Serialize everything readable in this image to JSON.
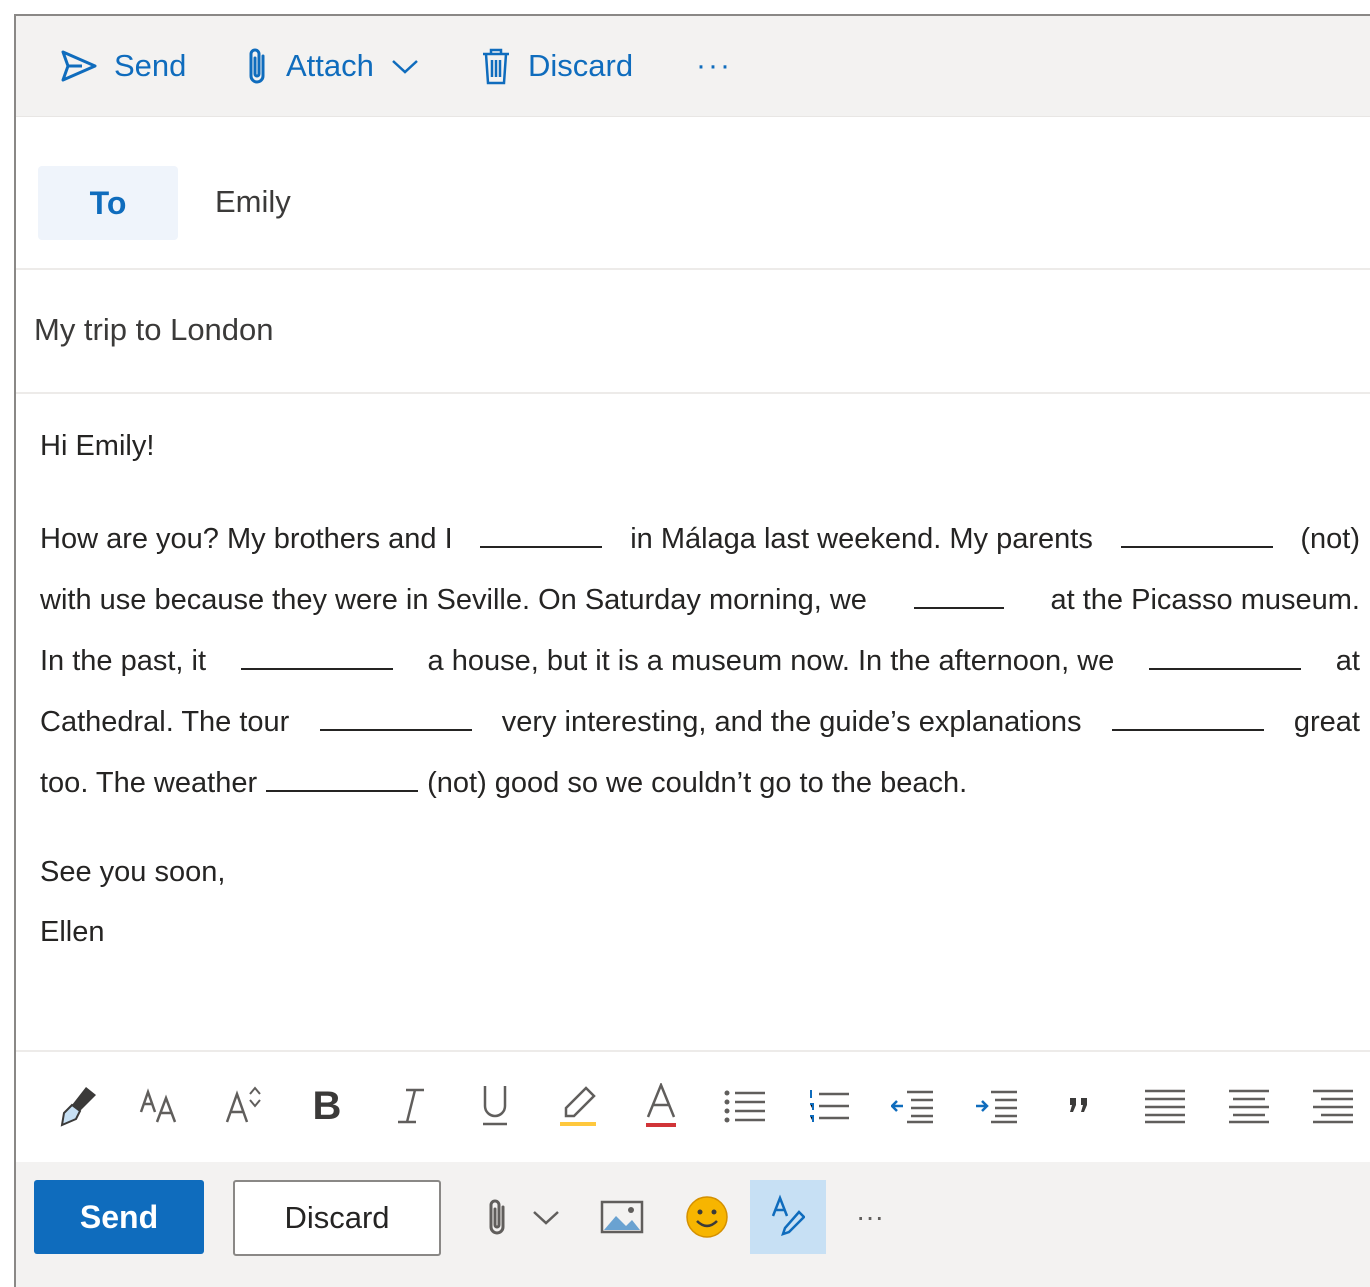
{
  "toolbar": {
    "send_label": "Send",
    "attach_label": "Attach",
    "discard_label": "Discard",
    "more_label": "···"
  },
  "recipients": {
    "to_label": "To",
    "to_value": "Emily"
  },
  "subject": "My trip to London",
  "message": {
    "greeting": "Hi Emily!",
    "lines": [
      [
        "How are you? My brothers and I",
        "in Málaga last weekend. My parents",
        "(not)"
      ],
      [
        "with use because they were in Seville. On Saturday morning, we",
        "at the Picasso museum."
      ],
      [
        "In the past, it",
        "a house, but it is a museum now. In the afternoon, we",
        "at"
      ],
      [
        "Cathedral. The tour",
        "very interesting, and the guide’s explanations",
        "great"
      ],
      [
        "too. The weather",
        "(not) good so we couldn’t go to the beach."
      ]
    ],
    "closing": "See you soon,",
    "signature": "Ellen"
  },
  "formatting_icons": [
    "format-painter-icon",
    "font-size-icon",
    "grow-font-icon",
    "bold-icon",
    "italic-icon",
    "underline-icon",
    "highlight-icon",
    "font-color-icon",
    "bullets-icon",
    "numbering-icon",
    "decrease-indent-icon",
    "increase-indent-icon",
    "quote-icon",
    "align-left-icon",
    "align-center-icon",
    "align-right-icon"
  ],
  "bottom": {
    "send_label": "Send",
    "discard_label": "Discard",
    "more_label": "···"
  },
  "colors": {
    "accent": "#0f6cbd",
    "toolbar_bg": "#f3f2f1",
    "to_bg": "#eff4fb",
    "format_active": "#c7e0f4",
    "highlight": "#ffc83d",
    "font_color": "#d13438",
    "emoji": "#f7b500"
  }
}
